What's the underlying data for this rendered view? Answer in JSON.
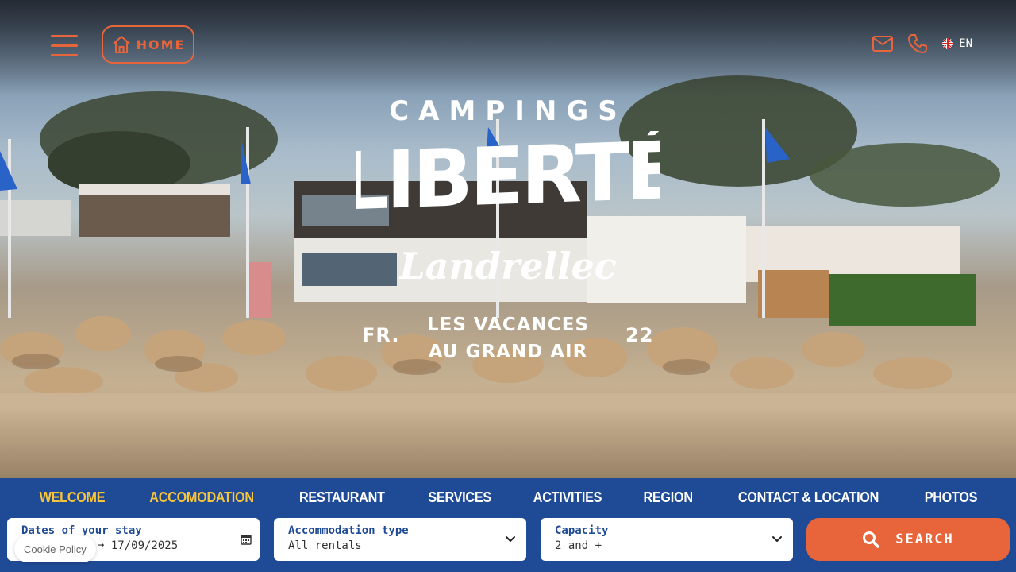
{
  "header": {
    "menu_icon": "hamburger-icon",
    "home_label": "HOME",
    "mail_icon": "mail-icon",
    "phone_icon": "phone-icon",
    "language": "EN"
  },
  "hero": {
    "brand_top": "CAMPINGS",
    "brand_main": "LIBERTÉ",
    "brand_script": "Landrellec",
    "tagline_line1": "LES VACANCES",
    "tagline_line2": "AU GRAND AIR",
    "left_mark": "FR.",
    "right_mark": "22"
  },
  "nav": {
    "items": [
      {
        "label": "WELCOME",
        "active": true
      },
      {
        "label": "ACCOMODATION",
        "active": true
      },
      {
        "label": "RESTAURANT",
        "active": false
      },
      {
        "label": "SERVICES",
        "active": false
      },
      {
        "label": "ACTIVITIES",
        "active": false
      },
      {
        "label": "REGION",
        "active": false
      },
      {
        "label": "CONTACT & LOCATION",
        "active": false
      },
      {
        "label": "PHOTOS",
        "active": false
      }
    ]
  },
  "booking": {
    "dates_label": "Dates of your stay",
    "dates_value": "17/09/2025",
    "type_label": "Accommodation type",
    "type_value": "All rentals",
    "capacity_label": "Capacity",
    "capacity_value": "2 and +",
    "search_label": "SEARCH"
  },
  "cookie": {
    "label": "Cookie Policy"
  },
  "colors": {
    "accent": "#e8643b",
    "bar": "#1f4a95",
    "nav_active": "#f6c53c"
  }
}
